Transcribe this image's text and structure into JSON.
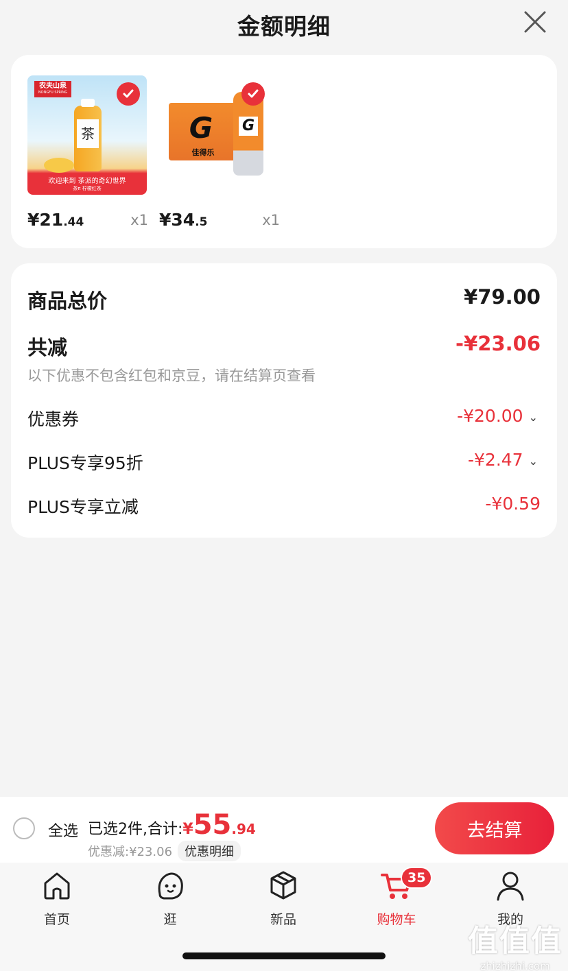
{
  "header": {
    "title": "金额明细"
  },
  "products": [
    {
      "price_main": "¥21",
      "price_dec": ".44",
      "qty": "x1",
      "brand": "农夫山泉",
      "brand_en": "NONGFU SPRING",
      "caption": "欢迎来到 茶派的奇幻世界",
      "subcaption": "茶π 柠檬红茶",
      "tea_char": "茶"
    },
    {
      "price_main": "¥34",
      "price_dec": ".5",
      "qty": "x1",
      "brand": "佳得乐"
    }
  ],
  "detail": {
    "total_label": "商品总价",
    "total_value": "¥79.00",
    "reduce_label": "共减",
    "reduce_value": "-¥23.06",
    "note": "以下优惠不包含红包和京豆，请在结算页查看",
    "coupon_label": "优惠券",
    "coupon_value": "-¥20.00",
    "plus_discount_label": "PLUS专享95折",
    "plus_discount_value": "-¥2.47",
    "plus_reduce_label": "PLUS专享立减",
    "plus_reduce_value": "-¥0.59"
  },
  "checkout": {
    "select_all": "全选",
    "selected_text": "已选2件,合计:",
    "total_yen": "¥",
    "total_int": "55",
    "total_dec": ".94",
    "discount_text": "优惠减:¥23.06",
    "detail_chip": "优惠明细",
    "button": "去结算"
  },
  "tabs": [
    {
      "label": "首页",
      "icon": "home-icon"
    },
    {
      "label": "逛",
      "icon": "face-icon"
    },
    {
      "label": "新品",
      "icon": "cube-icon"
    },
    {
      "label": "购物车",
      "icon": "cart-icon",
      "badge": "35",
      "active": true
    },
    {
      "label": "我的",
      "icon": "user-icon"
    }
  ],
  "watermark": {
    "text": "值值值",
    "url": "zhizhizhi.com"
  },
  "colors": {
    "accent": "#e8313a",
    "background": "#f4f4f4"
  }
}
